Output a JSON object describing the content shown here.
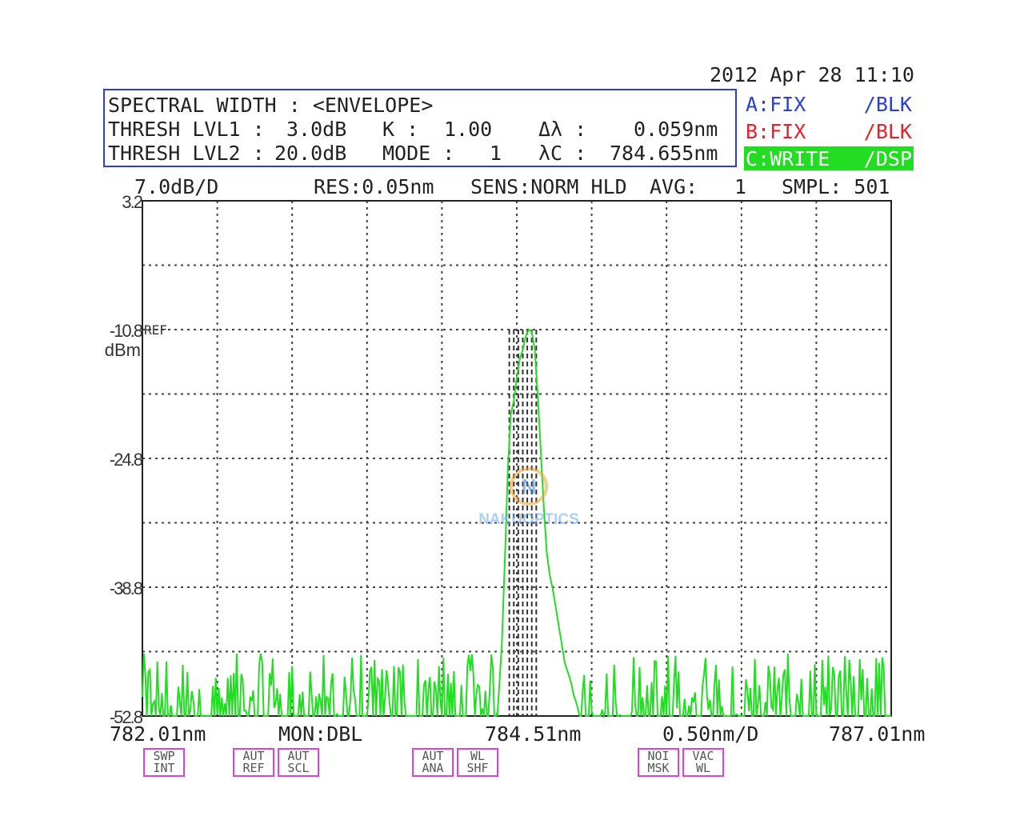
{
  "header": {
    "datetime": "2012 Apr 28 11:10"
  },
  "analysis": {
    "line1": "SPECTRAL WIDTH : <ENVELOPE>",
    "thresh1_label": "THRESH LVL1 :",
    "thresh1_value": "3.0dB",
    "thresh2_label": "THRESH LVL2 :",
    "thresh2_value": "20.0dB",
    "k_label": "K :",
    "k_value": "1.00",
    "mode_label": "MODE :",
    "mode_value": "1",
    "dl_label": "Δλ :",
    "dl_value": "0.059nm",
    "lc_label": "λC :",
    "lc_value": "784.655nm"
  },
  "traces": [
    {
      "name": "A:FIX",
      "mode": "/BLK",
      "color": "#2a3fd6"
    },
    {
      "name": "B:FIX",
      "mode": "/BLK",
      "color": "#e8202a"
    },
    {
      "name": "C:WRITE",
      "mode": "/DSP",
      "color": "#22dd22"
    }
  ],
  "status": {
    "scale": "7.0dB/D",
    "res": "RES:0.05nm",
    "sens": "SENS:NORM HLD",
    "avg_label": "AVG:",
    "avg_value": "1",
    "smpl": "SMPL: 501"
  },
  "bottom": {
    "start": "782.01nm",
    "mon": "MON:DBL",
    "center": "784.51nm",
    "span_div": "0.50nm/D",
    "stop": "787.01nm"
  },
  "softkeys": [
    {
      "top": "SWP",
      "bottom": "INT"
    },
    {
      "top": "AUT",
      "bottom": "REF"
    },
    {
      "top": "AUT",
      "bottom": "SCL"
    },
    {
      "top": "AUT",
      "bottom": "ANA"
    },
    {
      "top": "WL",
      "bottom": "SHF"
    },
    {
      "top": "NOI",
      "bottom": "MSK"
    },
    {
      "top": "VAC",
      "bottom": "WL"
    }
  ],
  "watermark": {
    "logo_letter": "N",
    "text": "NAKUOPTICS"
  },
  "chart_data": {
    "type": "line",
    "xlabel": "",
    "ylabel": "dBm",
    "xlim": [
      782.01,
      787.01
    ],
    "ylim": [
      -52.8,
      3.2
    ],
    "y_ticks": [
      "3.2",
      "-10.8",
      "-24.8",
      "-38.8",
      "-52.8"
    ],
    "ref_label": "REF",
    "ref_level": -10.8,
    "grid": true,
    "series": [
      {
        "color": "#22dd22",
        "peak": [
          [
            784.38,
            -52.8
          ],
          [
            784.41,
            -45
          ],
          [
            784.43,
            -36
          ],
          [
            784.45,
            -26
          ],
          [
            784.47,
            -20
          ],
          [
            784.49,
            -18.5
          ],
          [
            784.51,
            -16
          ],
          [
            784.53,
            -14
          ],
          [
            784.55,
            -13
          ],
          [
            784.57,
            -11.5
          ],
          [
            784.59,
            -10.8
          ],
          [
            784.61,
            -11
          ],
          [
            784.63,
            -13
          ],
          [
            784.65,
            -18
          ],
          [
            784.67,
            -24
          ],
          [
            784.69,
            -30
          ],
          [
            784.71,
            -35
          ],
          [
            784.73,
            -37.5
          ],
          [
            784.75,
            -39
          ],
          [
            784.77,
            -41
          ],
          [
            784.79,
            -43
          ],
          [
            784.81,
            -45
          ],
          [
            784.83,
            -47
          ],
          [
            784.85,
            -48
          ],
          [
            784.87,
            -49
          ],
          [
            784.89,
            -50.5
          ],
          [
            784.91,
            -51.5
          ],
          [
            784.93,
            -52.8
          ]
        ],
        "noise_floor": -52.8,
        "noise_peak_max": -46
      }
    ],
    "markers": [
      784.46,
      784.49,
      784.52,
      784.55,
      784.58,
      784.61,
      784.64
    ]
  }
}
